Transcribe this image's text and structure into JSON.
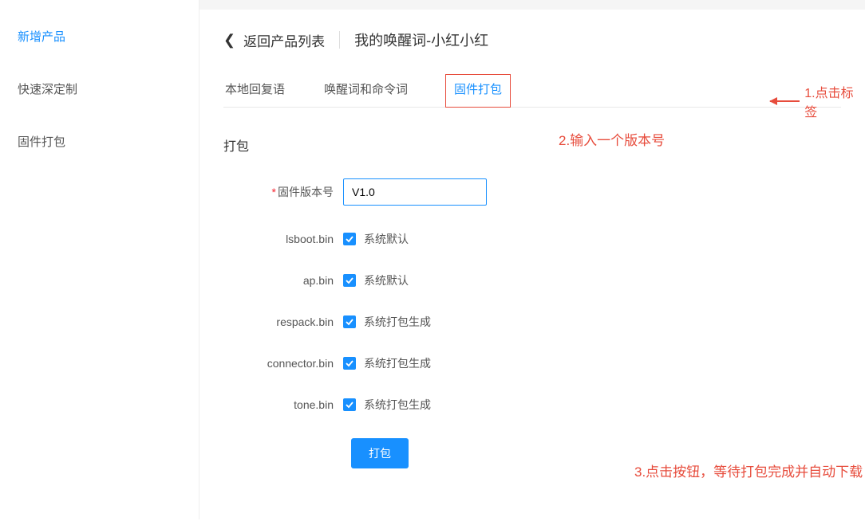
{
  "sidebar": {
    "items": [
      {
        "label": "新增产品",
        "active": true
      },
      {
        "label": "快速深定制",
        "active": false
      },
      {
        "label": "固件打包",
        "active": false
      }
    ]
  },
  "breadcrumb": {
    "back_label": "返回产品列表",
    "title": "我的唤醒词-小红小红"
  },
  "tabs": [
    {
      "label": "本地回复语",
      "active": false
    },
    {
      "label": "唤醒词和命令词",
      "active": false
    },
    {
      "label": "固件打包",
      "active": true
    }
  ],
  "section": {
    "title": "打包"
  },
  "form": {
    "version_label": "固件版本号",
    "version_value": "V1.0",
    "items": [
      {
        "label": "lsboot.bin",
        "desc": "系统默认"
      },
      {
        "label": "ap.bin",
        "desc": "系统默认"
      },
      {
        "label": "respack.bin",
        "desc": "系统打包生成"
      },
      {
        "label": "connector.bin",
        "desc": "系统打包生成"
      },
      {
        "label": "tone.bin",
        "desc": "系统打包生成"
      }
    ],
    "submit_label": "打包"
  },
  "annotations": {
    "a1": "1.点击标签",
    "a2": "2.输入一个版本号",
    "a3": "3.点击按钮，等待打包完成并自动下载"
  }
}
